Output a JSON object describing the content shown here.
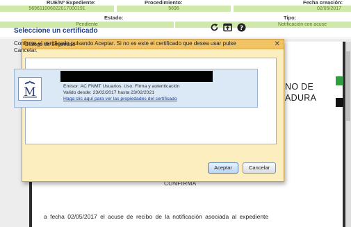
{
  "header": {
    "expediente_label": "RUE/Nº Expediente:",
    "expediente_value": "569611006022017000191",
    "procedimiento_label": "Procedimiento:",
    "procedimiento_value": "5696",
    "fecha_label": "Fecha creación:",
    "fecha_value": "02/05/2017",
    "estado_label": "Estado:",
    "estado_value": "Pendiente",
    "tipo_label": "Tipo:",
    "tipo_value": "Notificación con acuse"
  },
  "document": {
    "heading_line1": "NO DE",
    "heading_line2": "ADURA",
    "confirma": "CONFIRMA",
    "body_text": "a fecha 02/05/2017 el acuse de recibo de la notificación asociada al expediente"
  },
  "dialog": {
    "title": "Diálogo de Seguridad",
    "close_glyph": "✕",
    "heading": "Seleccione un certificado",
    "instructions": "Confirme el certificado pulsando Aceptar. Si no es este el certificado que desea usar pulse Cancelar.",
    "certificate": {
      "emisor": "Emisor: AC FNMT Usuarios. Uso: Firma y autenticación",
      "validez": "Valido desde: 23/02/2017 hasta 23/02/2021",
      "link": "Haga clic aquí para ver las propiedades del certificado"
    },
    "accept_label": "Aceptar",
    "cancel_label": "Cancelar",
    "icons": [
      "refresh-icon",
      "export-icon",
      "help-icon"
    ]
  },
  "colors": {
    "value_bg": "#cfe9a8",
    "dialog_bg": "#fdeec0",
    "titlebar": "#f2c363",
    "heading_blue": "#1e3f8a",
    "doc_green": "#2e9e3f"
  }
}
